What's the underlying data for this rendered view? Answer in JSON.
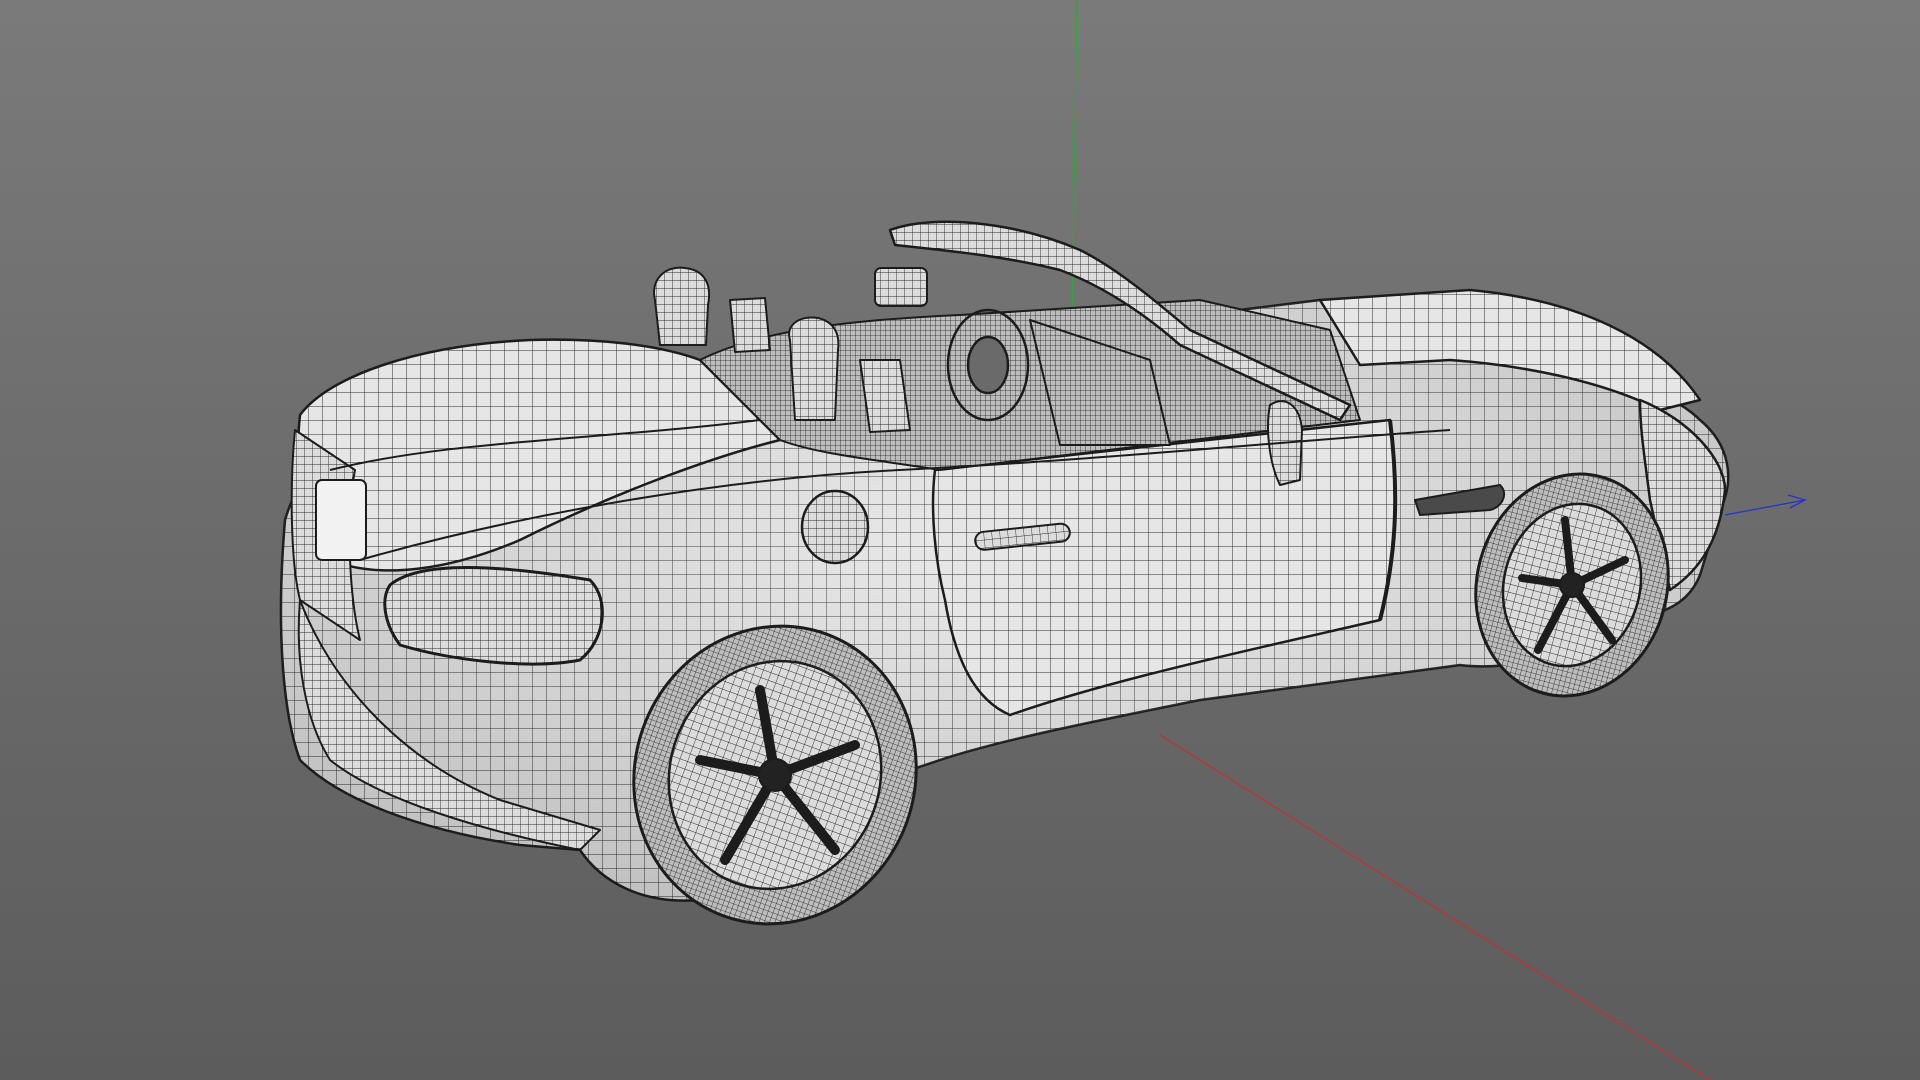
{
  "viewport": {
    "background_top": "#7a7a7a",
    "background_bottom": "#5c5c5c"
  },
  "axes": {
    "x_color": "#c0322e",
    "y_color": "#2fa83a",
    "z_color": "#2a33c8"
  },
  "model": {
    "subject": "convertible-car",
    "display_mode": "wireframe-on-shaded",
    "surface_color": "#e9e9e9",
    "wire_color": "#1c1c1c"
  }
}
